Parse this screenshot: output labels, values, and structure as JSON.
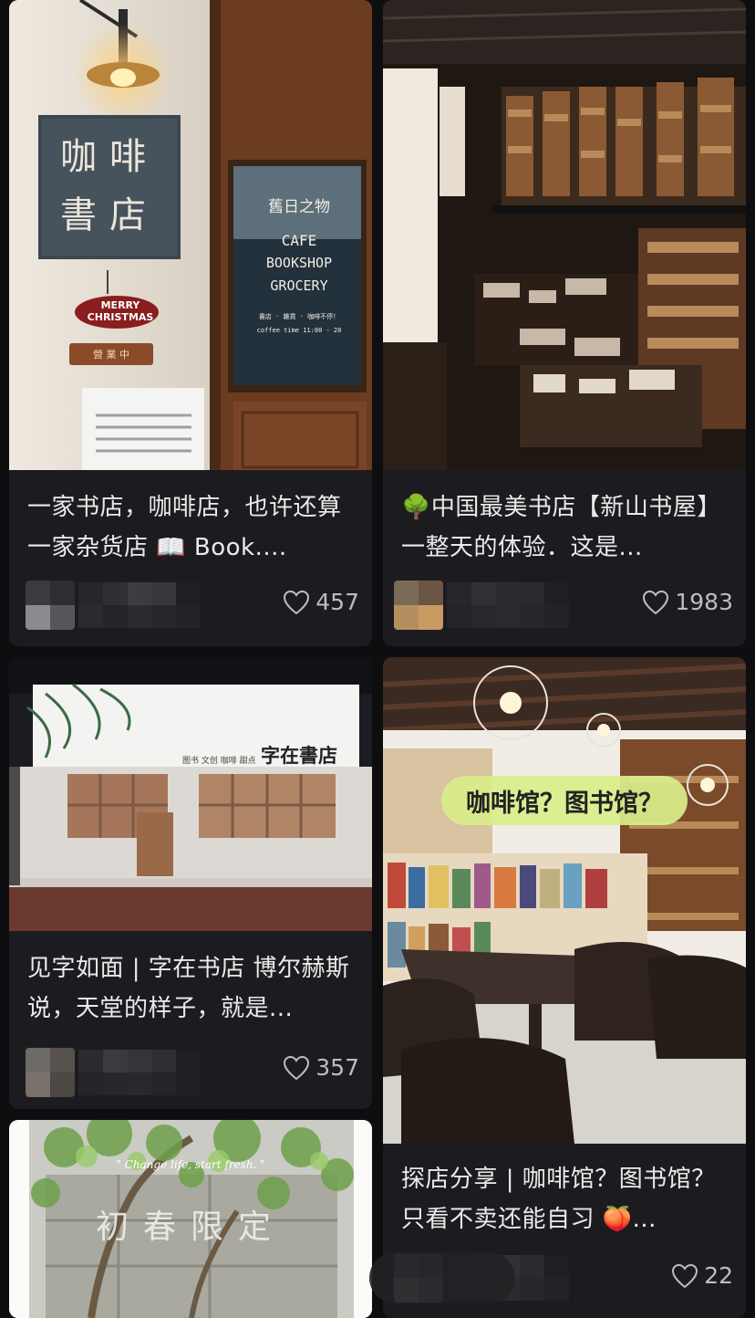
{
  "feed": {
    "posts": [
      {
        "image_sign_chars": [
          "咖",
          "啡",
          "書",
          "店"
        ],
        "image_door_lines": [
          "舊日之物",
          "CAFE",
          "BOOKSHOP",
          "GROCERY"
        ],
        "image_door_small": "書店 · 雜貨 · 咖啡不停！",
        "image_door_time": "coffee time 11:00 -  20",
        "image_badge": "MERRY CHRISTMAS",
        "image_open": "營 業 中",
        "title": "一家书店，咖啡店，也许还算一家杂货店 📖 Book....",
        "likes": "457"
      },
      {
        "title": "🌳中国最美书店【新山书屋】一整天的体验．这是...",
        "likes": "1983"
      },
      {
        "image_sign_main": "字在書店",
        "image_sign_sub": "图书 文创 咖啡 甜点",
        "title": "见字如面 | 字在书店 博尔赫斯说，天堂的样子，就是...",
        "likes": "357"
      },
      {
        "image_overlay": "咖啡馆？图书馆？",
        "title": "探店分享 | 咖啡馆？图书馆？只看不卖还能自习 🍑...",
        "likes": "22"
      },
      {
        "image_quote": "\" Change life, start fresh. \"",
        "image_caption": "初春限定"
      }
    ]
  }
}
